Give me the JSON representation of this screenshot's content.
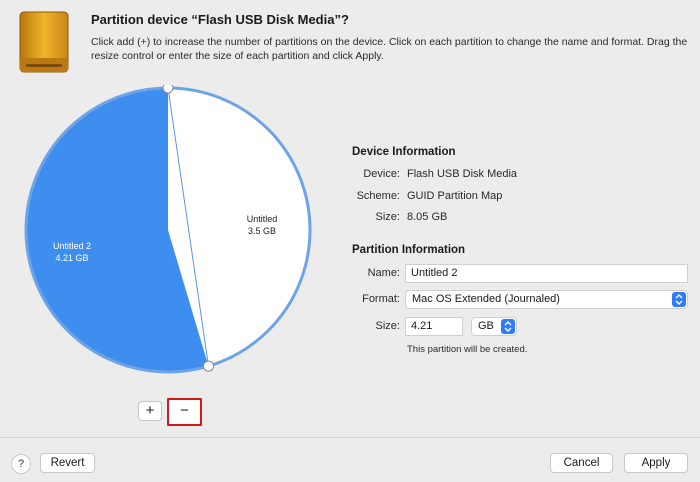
{
  "header": {
    "title": "Partition device “Flash USB Disk Media”?",
    "description": "Click add (+) to increase the number of partitions on the device. Click on each partition to change the name and format. Drag the resize control or enter the size of each partition and click Apply.",
    "icon": "external-drive-icon"
  },
  "pie": {
    "partitions": [
      {
        "name": "Untitled 2",
        "size": "4.21 GB",
        "fraction": 0.546,
        "color": "#3e8ef0",
        "selected": true
      },
      {
        "name": "Untitled",
        "size": "3.5 GB",
        "fraction": 0.454,
        "color": "#ffffff",
        "selected": false
      }
    ],
    "outline_color": "#6fa3e8"
  },
  "controls": {
    "add_label": "+",
    "remove_label": "−"
  },
  "device_info": {
    "title": "Device Information",
    "device_label": "Device:",
    "device_value": "Flash USB Disk Media",
    "scheme_label": "Scheme:",
    "scheme_value": "GUID Partition Map",
    "size_label": "Size:",
    "size_value": "8.05 GB"
  },
  "partition_info": {
    "title": "Partition Information",
    "name_label": "Name:",
    "name_value": "Untitled 2",
    "format_label": "Format:",
    "format_value": "Mac OS Extended (Journaled)",
    "size_label": "Size:",
    "size_value": "4.21",
    "unit_value": "GB",
    "note": "This partition will be created."
  },
  "footer": {
    "help_label": "?",
    "revert_label": "Revert",
    "cancel_label": "Cancel",
    "apply_label": "Apply"
  },
  "colors": {
    "accent": "#2f7cf6",
    "highlight": "#d11a1a"
  }
}
